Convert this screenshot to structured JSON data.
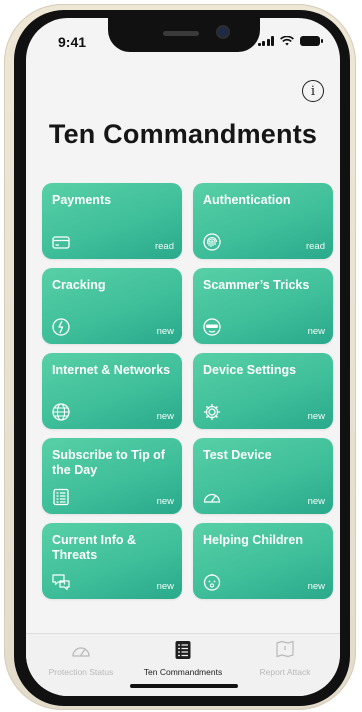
{
  "status": {
    "time": "9:41"
  },
  "page": {
    "title": "Ten Commandments"
  },
  "tiles": [
    {
      "label": "Payments",
      "tag": "read",
      "icon": "card-icon"
    },
    {
      "label": "Authentication",
      "tag": "read",
      "icon": "fingerprint-icon"
    },
    {
      "label": "Cracking",
      "tag": "new",
      "icon": "cracking-icon"
    },
    {
      "label": "Scammer’s Tricks",
      "tag": "new",
      "icon": "scammer-mask-icon"
    },
    {
      "label": "Internet & Networks",
      "tag": "new",
      "icon": "globe-icon"
    },
    {
      "label": "Device Settings",
      "tag": "new",
      "icon": "gear-icon"
    },
    {
      "label": "Subscribe to Tip of the Day",
      "tag": "new",
      "icon": "list-icon"
    },
    {
      "label": "Test Device",
      "tag": "new",
      "icon": "gauge-icon"
    },
    {
      "label": "Current Info & Threats",
      "tag": "new",
      "icon": "chat-alert-icon"
    },
    {
      "label": "Helping Children",
      "tag": "new",
      "icon": "child-face-icon"
    }
  ],
  "tabs": [
    {
      "label": "Protection Status",
      "icon": "gauge-icon",
      "active": false
    },
    {
      "label": "Ten Commandments",
      "icon": "list-icon",
      "active": true
    },
    {
      "label": "Report Attack",
      "icon": "flag-icon",
      "active": false
    }
  ],
  "colors": {
    "tile_gradient_start": "#58d0a6",
    "tile_gradient_end": "#2aa98c",
    "active_tab": "#1e1e1e",
    "inactive_tab": "#b9b9b9"
  }
}
